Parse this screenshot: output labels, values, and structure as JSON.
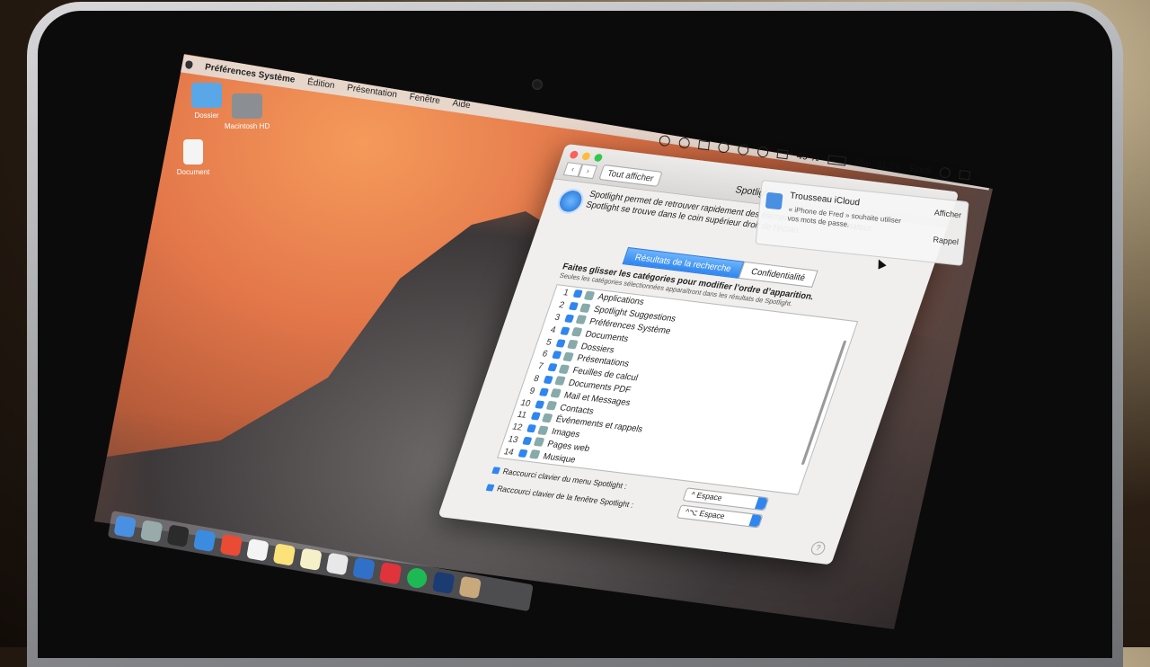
{
  "menubar": {
    "app_name": "Préférences Système",
    "items": [
      "Édition",
      "Présentation",
      "Fenêtre",
      "Aide"
    ]
  },
  "desktop_icons": [
    {
      "label": "Dossier"
    },
    {
      "label": "Macintosh HD"
    },
    {
      "label": "Document"
    }
  ],
  "status": {
    "battery": "49 %",
    "clock": "Mar. 11:29",
    "user": "Fred"
  },
  "window": {
    "show_all": "Tout afficher",
    "title_partial": "Spotlight",
    "description": "Spotlight permet de retrouver rapidement des éléments sur votre ordinateur. Spotlight se trouve dans le coin supérieur droit de l’écran.",
    "tabs": [
      "Résultats de la recherche",
      "Confidentialité"
    ],
    "hint_title": "Faites glisser les catégories pour modifier l’ordre d’apparition.",
    "hint_sub": "Seules les catégories sélectionnées apparaîtront dans les résultats de Spotlight.",
    "categories": [
      {
        "num": "1",
        "label": "Applications"
      },
      {
        "num": "2",
        "label": "Spotlight Suggestions"
      },
      {
        "num": "3",
        "label": "Préférences Système"
      },
      {
        "num": "4",
        "label": "Documents"
      },
      {
        "num": "5",
        "label": "Dossiers"
      },
      {
        "num": "6",
        "label": "Présentations"
      },
      {
        "num": "7",
        "label": "Feuilles de calcul"
      },
      {
        "num": "8",
        "label": "Documents PDF"
      },
      {
        "num": "9",
        "label": "Mail et Messages"
      },
      {
        "num": "10",
        "label": "Contacts"
      },
      {
        "num": "11",
        "label": "Événements et rappels"
      },
      {
        "num": "12",
        "label": "Images"
      },
      {
        "num": "13",
        "label": "Pages web"
      },
      {
        "num": "14",
        "label": "Musique"
      }
    ],
    "shortcut_menu_label": "Raccourci clavier du menu Spotlight :",
    "shortcut_menu_value": "^ Espace",
    "shortcut_window_label": "Raccourci clavier de la fenêtre Spotlight :",
    "shortcut_window_value": "^⌥ Espace",
    "help": "?"
  },
  "notification": {
    "title": "Trousseau iCloud",
    "subtitle": "« iPhone de Fred » souhaite utiliser vos mots de passe.",
    "btn_show": "Afficher",
    "btn_later": "Rappel"
  }
}
